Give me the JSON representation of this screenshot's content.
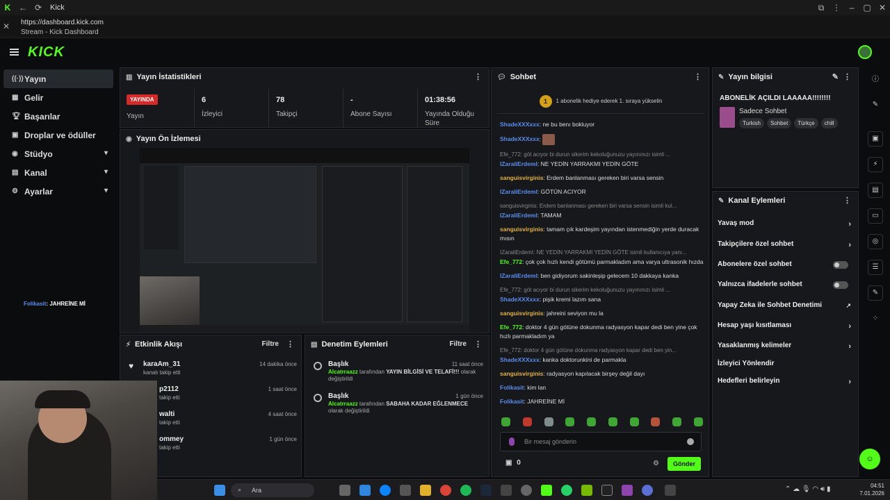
{
  "browser": {
    "tab_title": "Kick",
    "url": "https://dashboard.kick.com",
    "page_title": "Stream - Kick Dashboard"
  },
  "header": {
    "logo": "KICK"
  },
  "sidebar": {
    "items": [
      {
        "label": "Yayın",
        "icon": "broadcast-icon",
        "active": true
      },
      {
        "label": "Gelir",
        "icon": "revenue-icon"
      },
      {
        "label": "Başarılar",
        "icon": "trophy-icon"
      },
      {
        "label": "Droplar ve ödüller",
        "icon": "gift-icon"
      },
      {
        "label": "Stüdyo",
        "icon": "studio-icon",
        "expandable": true
      },
      {
        "label": "Kanal",
        "icon": "channel-icon",
        "expandable": true
      },
      {
        "label": "Ayarlar",
        "icon": "settings-icon",
        "expandable": true
      }
    ],
    "overlay_user": "Folikasit",
    "overlay_text": "JAHREİNE Mİ"
  },
  "stats": {
    "title": "Yayın İstatistikleri",
    "live_badge": "YAYINDA",
    "live_label": "Yayın",
    "viewers": {
      "value": "6",
      "label": "İzleyici"
    },
    "followers": {
      "value": "78",
      "label": "Takipçi"
    },
    "subs": {
      "value": "-",
      "label": "Abone Sayısı"
    },
    "duration": {
      "value": "01:38:56",
      "label": "Yayında Olduğu Süre"
    }
  },
  "preview": {
    "title": "Yayın Ön İzlemesi"
  },
  "activity": {
    "title": "Etkinlik Akışı",
    "filter": "Filtre",
    "items": [
      {
        "name": "karaAm_31",
        "sub": "kanalı takip etti",
        "time": "14 dakika önce"
      },
      {
        "name": "p2112",
        "sub": "takip etti",
        "time": "1 saat önce"
      },
      {
        "name": "walti",
        "sub": "takip etti",
        "time": "4 saat önce"
      },
      {
        "name": "ommey",
        "sub": "takip etti",
        "time": "1 gün önce"
      }
    ]
  },
  "moderation": {
    "title": "Denetim Eylemleri",
    "filter": "Filtre",
    "items": [
      {
        "head": "Başlık",
        "user": "Alcatrraazz",
        "mid": "tarafından",
        "value": "YAYIN BİLGİSİ VE TELAFİ!!!",
        "tail": "olarak değiştirildi",
        "time": "11 saat önce"
      },
      {
        "head": "Başlık",
        "user": "Alcatrraazz",
        "mid": "tarafından",
        "value": "SABAHA KADAR EĞLENMECE",
        "tail": "olarak değiştirildi",
        "time": "1 gün önce"
      }
    ]
  },
  "chat": {
    "title": "Sohbet",
    "sub_coin": "1",
    "sub_text": "1 abonelik hediye ederek 1. sıraya yükselin",
    "messages": [
      {
        "user": "ShadeXXXxxx",
        "color": "#5b8def",
        "text": "ne bu benı bokluyor"
      },
      {
        "user": "ShadeXXXxxx",
        "color": "#5b8def",
        "text": ""
      },
      {
        "reply": "Efe_772: göt acıyor bi durun sikerim kekoluğunuzu yayınınızı isimli ...",
        "user": "IZaraliErdemI",
        "color": "#5b8def",
        "text": "NE YEDİN YARRAKMI YEDİN GÖTE"
      },
      {
        "user": "sanguisvirginis",
        "color": "#e3b341",
        "text": "Erdem banlanması gereken biri varsa sensin"
      },
      {
        "user": "IZaraliErdemI",
        "color": "#5b8def",
        "text": "GÖTÜN ACIYOR"
      },
      {
        "reply": "sanguisvirginis: Erdem banlanması gereken biri varsa sensin isimli kul...",
        "user": "IZaraliErdemI",
        "color": "#5b8def",
        "text": "TAMAM"
      },
      {
        "user": "sanguisvirginis",
        "color": "#e3b341",
        "text": "tamam çık kardeşim yayından istenmediğin yerde duracak mısın"
      },
      {
        "reply": "IZaraliErdemI: NE YEDİN YARRAKMI YEDİN GÖTE isimli kullanıcıya yanı...",
        "user": "Efe_772",
        "color": "#53fc18",
        "text": "çok çok hızlı kendi götümü parmakladım ama varya ultrasonik hızda"
      },
      {
        "user": "IZaraliErdemI",
        "color": "#5b8def",
        "text": "ben gidiyorum sakinleşip gelecem 10 dakkaya kanka"
      },
      {
        "reply": "Efe_772: göt acıyor bi durun sikerim kekoluğunuzu yayınınızı isimli ...",
        "user": "ShadeXXXxxx",
        "color": "#5b8def",
        "text": "pişik kremi lazım sana"
      },
      {
        "user": "sanguisvirginis",
        "color": "#e3b341",
        "text": "jahreini seviyon mu la"
      },
      {
        "user": "Efe_772",
        "color": "#53fc18",
        "text": "doktor 4 gün götüne dokunma radyasyon kapar dedi ben yine çok hızlı parmakladım ya"
      },
      {
        "reply": "Efe_772: doktor 4 gün götüne dokunma radyasyon kapar dedi ben yin...",
        "user": "ShadeXXXxxx",
        "color": "#5b8def",
        "text": "kanka doktorunkini de parmakla"
      },
      {
        "user": "sanguisvirginis",
        "color": "#e3b341",
        "text": "radyasyon kapılacak birşey değil dayı"
      },
      {
        "user": "Folikasit",
        "color": "#5b8def",
        "text": "kim lan"
      },
      {
        "user": "Folikasit",
        "color": "#5b8def",
        "text": "JAHREİNE Mİ"
      }
    ],
    "input_placeholder": "Bir mesaj gönderin",
    "points": "0",
    "send": "Gönder"
  },
  "stream_info": {
    "title": "Yayın bilgisi",
    "stream_title": "ABONELİK AÇILDI LAAAAA!!!!!!!!",
    "category": "Sadece Sohbet",
    "tags": [
      "Turkish",
      "Sohbet",
      "Türkçe",
      "chill"
    ]
  },
  "channel_actions": {
    "title": "Kanal Eylemleri",
    "items": [
      {
        "label": "Yavaş mod",
        "kind": "arrow"
      },
      {
        "label": "Takipçilere özel sohbet",
        "kind": "arrow"
      },
      {
        "label": "Abonelere özel sohbet",
        "kind": "toggle"
      },
      {
        "label": "Yalnızca ifadelerle sohbet",
        "kind": "toggle"
      },
      {
        "label": "Yapay Zeka ile Sohbet Denetimi",
        "kind": "external"
      },
      {
        "label": "Hesap yaşı kısıtlaması",
        "kind": "arrow"
      },
      {
        "label": "Yasaklanmış kelimeler",
        "kind": "arrow"
      },
      {
        "label": "İzleyici Yönlendir",
        "kind": "none"
      },
      {
        "label": "Hedefleri belirleyin",
        "kind": "arrow"
      }
    ]
  },
  "taskbar": {
    "search": "Ara",
    "time": "04:51",
    "date": "7.01.2026"
  },
  "colors": {
    "brand": "#53fc18",
    "live": "#d42a2a",
    "panel": "#16181b"
  }
}
